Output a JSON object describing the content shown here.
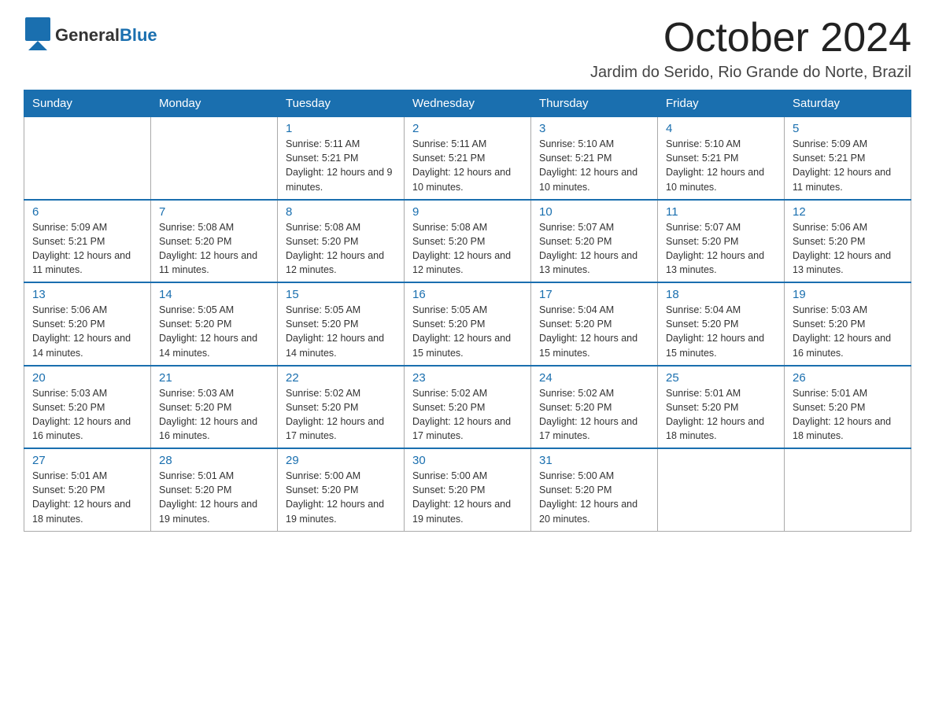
{
  "header": {
    "logo_general": "General",
    "logo_blue": "Blue",
    "month_title": "October 2024",
    "location": "Jardim do Serido, Rio Grande do Norte, Brazil"
  },
  "weekdays": [
    "Sunday",
    "Monday",
    "Tuesday",
    "Wednesday",
    "Thursday",
    "Friday",
    "Saturday"
  ],
  "weeks": [
    [
      {
        "day": "",
        "info": ""
      },
      {
        "day": "",
        "info": ""
      },
      {
        "day": "1",
        "info": "Sunrise: 5:11 AM\nSunset: 5:21 PM\nDaylight: 12 hours and 9 minutes."
      },
      {
        "day": "2",
        "info": "Sunrise: 5:11 AM\nSunset: 5:21 PM\nDaylight: 12 hours and 10 minutes."
      },
      {
        "day": "3",
        "info": "Sunrise: 5:10 AM\nSunset: 5:21 PM\nDaylight: 12 hours and 10 minutes."
      },
      {
        "day": "4",
        "info": "Sunrise: 5:10 AM\nSunset: 5:21 PM\nDaylight: 12 hours and 10 minutes."
      },
      {
        "day": "5",
        "info": "Sunrise: 5:09 AM\nSunset: 5:21 PM\nDaylight: 12 hours and 11 minutes."
      }
    ],
    [
      {
        "day": "6",
        "info": "Sunrise: 5:09 AM\nSunset: 5:21 PM\nDaylight: 12 hours and 11 minutes."
      },
      {
        "day": "7",
        "info": "Sunrise: 5:08 AM\nSunset: 5:20 PM\nDaylight: 12 hours and 11 minutes."
      },
      {
        "day": "8",
        "info": "Sunrise: 5:08 AM\nSunset: 5:20 PM\nDaylight: 12 hours and 12 minutes."
      },
      {
        "day": "9",
        "info": "Sunrise: 5:08 AM\nSunset: 5:20 PM\nDaylight: 12 hours and 12 minutes."
      },
      {
        "day": "10",
        "info": "Sunrise: 5:07 AM\nSunset: 5:20 PM\nDaylight: 12 hours and 13 minutes."
      },
      {
        "day": "11",
        "info": "Sunrise: 5:07 AM\nSunset: 5:20 PM\nDaylight: 12 hours and 13 minutes."
      },
      {
        "day": "12",
        "info": "Sunrise: 5:06 AM\nSunset: 5:20 PM\nDaylight: 12 hours and 13 minutes."
      }
    ],
    [
      {
        "day": "13",
        "info": "Sunrise: 5:06 AM\nSunset: 5:20 PM\nDaylight: 12 hours and 14 minutes."
      },
      {
        "day": "14",
        "info": "Sunrise: 5:05 AM\nSunset: 5:20 PM\nDaylight: 12 hours and 14 minutes."
      },
      {
        "day": "15",
        "info": "Sunrise: 5:05 AM\nSunset: 5:20 PM\nDaylight: 12 hours and 14 minutes."
      },
      {
        "day": "16",
        "info": "Sunrise: 5:05 AM\nSunset: 5:20 PM\nDaylight: 12 hours and 15 minutes."
      },
      {
        "day": "17",
        "info": "Sunrise: 5:04 AM\nSunset: 5:20 PM\nDaylight: 12 hours and 15 minutes."
      },
      {
        "day": "18",
        "info": "Sunrise: 5:04 AM\nSunset: 5:20 PM\nDaylight: 12 hours and 15 minutes."
      },
      {
        "day": "19",
        "info": "Sunrise: 5:03 AM\nSunset: 5:20 PM\nDaylight: 12 hours and 16 minutes."
      }
    ],
    [
      {
        "day": "20",
        "info": "Sunrise: 5:03 AM\nSunset: 5:20 PM\nDaylight: 12 hours and 16 minutes."
      },
      {
        "day": "21",
        "info": "Sunrise: 5:03 AM\nSunset: 5:20 PM\nDaylight: 12 hours and 16 minutes."
      },
      {
        "day": "22",
        "info": "Sunrise: 5:02 AM\nSunset: 5:20 PM\nDaylight: 12 hours and 17 minutes."
      },
      {
        "day": "23",
        "info": "Sunrise: 5:02 AM\nSunset: 5:20 PM\nDaylight: 12 hours and 17 minutes."
      },
      {
        "day": "24",
        "info": "Sunrise: 5:02 AM\nSunset: 5:20 PM\nDaylight: 12 hours and 17 minutes."
      },
      {
        "day": "25",
        "info": "Sunrise: 5:01 AM\nSunset: 5:20 PM\nDaylight: 12 hours and 18 minutes."
      },
      {
        "day": "26",
        "info": "Sunrise: 5:01 AM\nSunset: 5:20 PM\nDaylight: 12 hours and 18 minutes."
      }
    ],
    [
      {
        "day": "27",
        "info": "Sunrise: 5:01 AM\nSunset: 5:20 PM\nDaylight: 12 hours and 18 minutes."
      },
      {
        "day": "28",
        "info": "Sunrise: 5:01 AM\nSunset: 5:20 PM\nDaylight: 12 hours and 19 minutes."
      },
      {
        "day": "29",
        "info": "Sunrise: 5:00 AM\nSunset: 5:20 PM\nDaylight: 12 hours and 19 minutes."
      },
      {
        "day": "30",
        "info": "Sunrise: 5:00 AM\nSunset: 5:20 PM\nDaylight: 12 hours and 19 minutes."
      },
      {
        "day": "31",
        "info": "Sunrise: 5:00 AM\nSunset: 5:20 PM\nDaylight: 12 hours and 20 minutes."
      },
      {
        "day": "",
        "info": ""
      },
      {
        "day": "",
        "info": ""
      }
    ]
  ]
}
